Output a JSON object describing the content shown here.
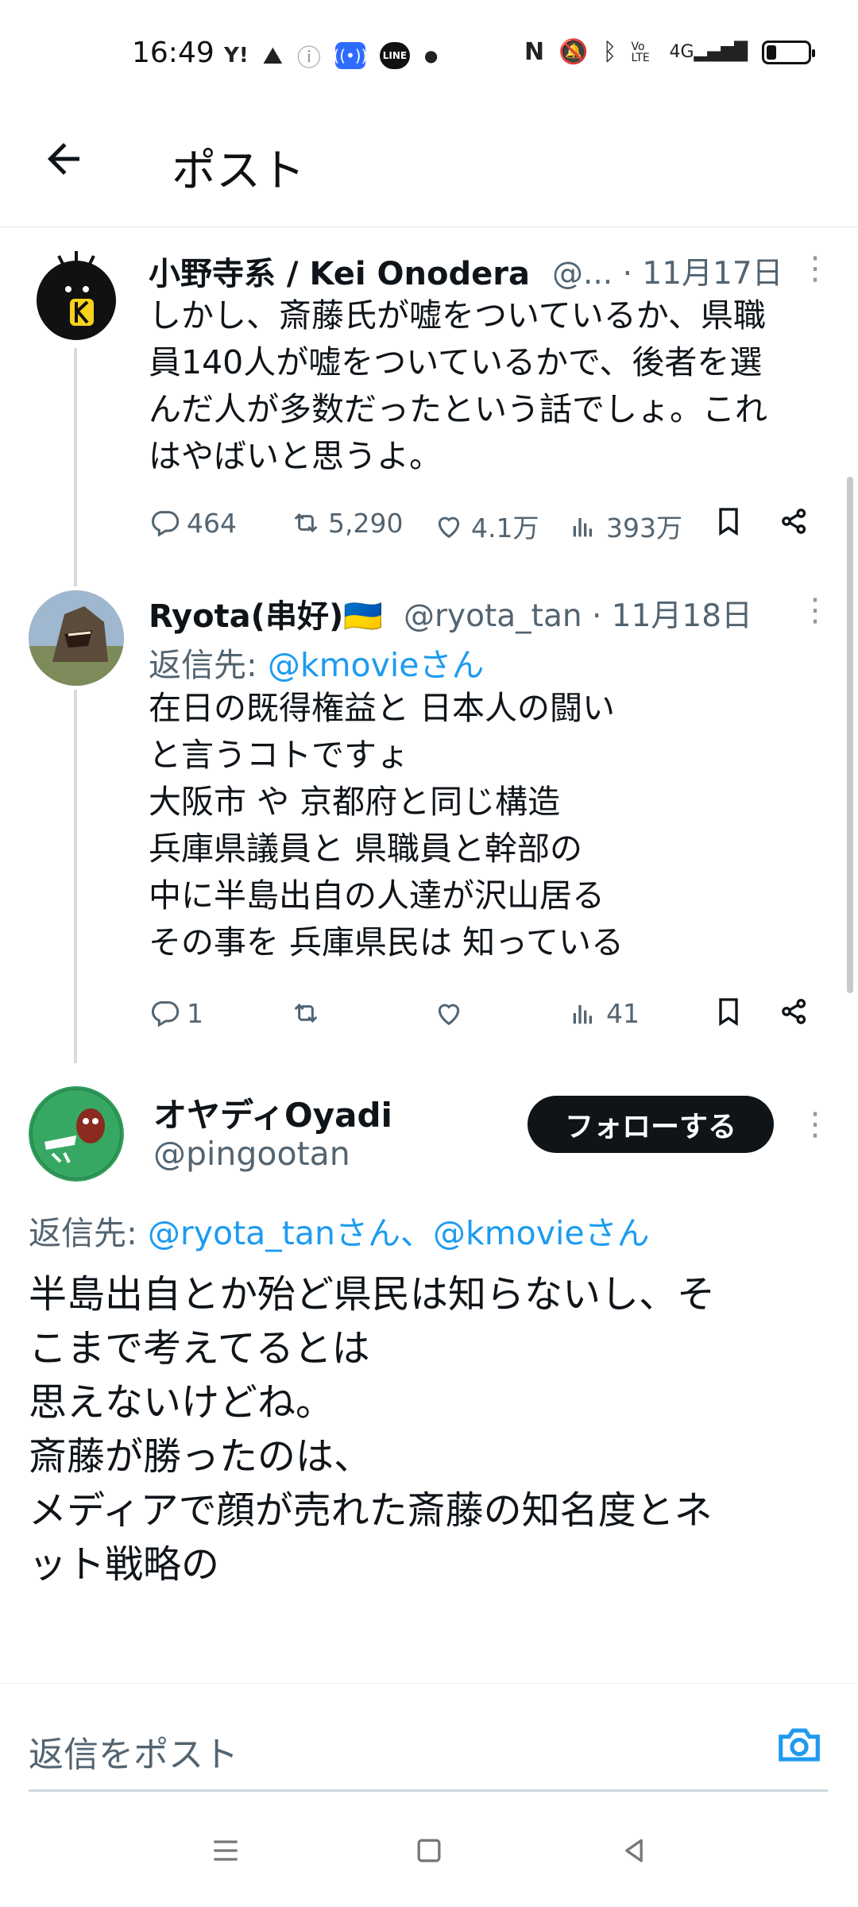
{
  "status_bar": {
    "time": "16:49",
    "icons": [
      "yahoo-icon",
      "mountain-icon",
      "info-icon",
      "nfc-broadcast-icon",
      "line-app-icon",
      "dot-icon"
    ],
    "right_icons": [
      "nfc-icon",
      "mute-icon",
      "bluetooth-icon",
      "volte-icon",
      "signal-4g-icon",
      "battery-icon"
    ],
    "line_label": "LINE",
    "volte_label": "Vo LTE",
    "network_label": "4G"
  },
  "header": {
    "title": "ポスト"
  },
  "tweets": [
    {
      "name": "小野寺系 / Kei Onodera",
      "handle_date": "@... · 11月17日",
      "body": "しかし、斎藤氏が嘘をついているか、県職\n員140人が嘘をついているかで、後者を選\nんだ人が多数だったという話でしょ。これ\nはやばいと思うよ。",
      "replies": "464",
      "retweets": "5,290",
      "likes": "4.1万",
      "views": "393万"
    },
    {
      "name": "Ryota(串好)🇺🇦",
      "handle_date": "@ryota_tan · 11月18日",
      "reply_to_prefix": "返信先: ",
      "reply_to_mention": "@kmovieさん",
      "body": "在日の既得権益と 日本人の闘い\nと言うコトですょ\n大阪市 や 京都府と同じ構造\n兵庫県議員と 県職員と幹部の\n中に半島出自の人達が沢山居る\nその事を 兵庫県民は 知っている",
      "replies": "1",
      "retweets": "",
      "likes": "",
      "views": "41"
    },
    {
      "name": "オヤディOyadi",
      "handle": "@pingootan",
      "follow_label": "フォローする",
      "reply_to_prefix": "返信先: ",
      "reply_to_mention": "@ryota_tanさん、@kmovieさん",
      "body": "半島出自とか殆ど県民は知らないし、そ\nこまで考えてるとは\n思えないけどね。\n斎藤が勝ったのは、\nメディアで顔が売れた斎藤の知名度とネ\nット戦略の"
    }
  ],
  "reply_bar": {
    "placeholder": "返信をポスト"
  },
  "nav_bar": {
    "icons": [
      "menu-icon",
      "home-square-icon",
      "back-triangle-icon"
    ]
  }
}
